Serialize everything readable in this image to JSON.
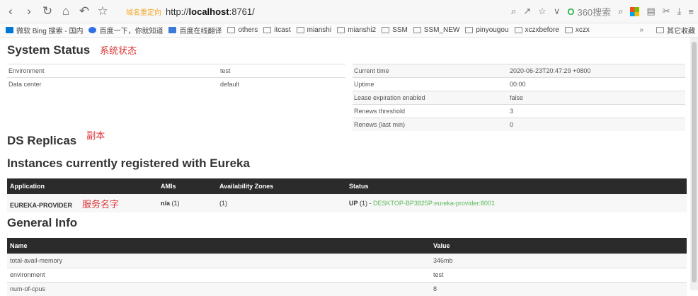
{
  "browser": {
    "redirect_tag": "域名重定向",
    "url_prefix": "http://",
    "url_host": "localhost",
    "url_rest": ":8761/",
    "search_label": "360搜索",
    "search_logo": "O"
  },
  "bookmarks": [
    {
      "label": "微软 Bing 搜索 - 国内",
      "icon": "bing"
    },
    {
      "label": "百度一下，你就知道",
      "icon": "baidu"
    },
    {
      "label": "百度在线翻译",
      "icon": "trans"
    },
    {
      "label": "others",
      "icon": "folder"
    },
    {
      "label": "itcast",
      "icon": "folder"
    },
    {
      "label": "mianshi",
      "icon": "folder"
    },
    {
      "label": "mianshi2",
      "icon": "folder"
    },
    {
      "label": "SSM",
      "icon": "folder"
    },
    {
      "label": "SSM_NEW",
      "icon": "folder"
    },
    {
      "label": "pinyougou",
      "icon": "folder"
    },
    {
      "label": "xczxbefore",
      "icon": "folder"
    },
    {
      "label": "xczx",
      "icon": "folder"
    }
  ],
  "bookmarks_more": "»",
  "bookmarks_other": "其它收藏",
  "system_status": {
    "title": "System Status",
    "note": "系统状态",
    "left_rows": [
      {
        "key": "Environment",
        "value": "test"
      },
      {
        "key": "Data center",
        "value": "default"
      }
    ],
    "right_rows": [
      {
        "key": "Current time",
        "value": "2020-06-23T20:47:29 +0800"
      },
      {
        "key": "Uptime",
        "value": "00:00"
      },
      {
        "key": "Lease expiration enabled",
        "value": "false"
      },
      {
        "key": "Renews threshold",
        "value": "3"
      },
      {
        "key": "Renews (last min)",
        "value": "0"
      }
    ]
  },
  "replicas": {
    "title": "DS Replicas",
    "note": "副本"
  },
  "instances": {
    "title": "Instances currently registered with Eureka",
    "headers": [
      "Application",
      "AMIs",
      "Availability Zones",
      "Status"
    ],
    "row": {
      "application": "EUREKA-PROVIDER",
      "note": "服务名字",
      "amis_bold": "n/a",
      "amis_count": " (1)",
      "zones": "(1)",
      "status_prefix": "UP",
      "status_count": " (1) - ",
      "status_link": "DESKTOP-BP3825P:eureka-provider:8001"
    }
  },
  "general_info": {
    "title": "General Info",
    "headers": [
      "Name",
      "Value"
    ],
    "rows": [
      {
        "key": "total-avail-memory",
        "value": "346mb"
      },
      {
        "key": "environment",
        "value": "test"
      },
      {
        "key": "num-of-cpus",
        "value": "8"
      }
    ]
  },
  "colors": {
    "accent_green": "#5cb85c",
    "note_red": "#dd3333",
    "header_dark": "#2b2b2b"
  }
}
